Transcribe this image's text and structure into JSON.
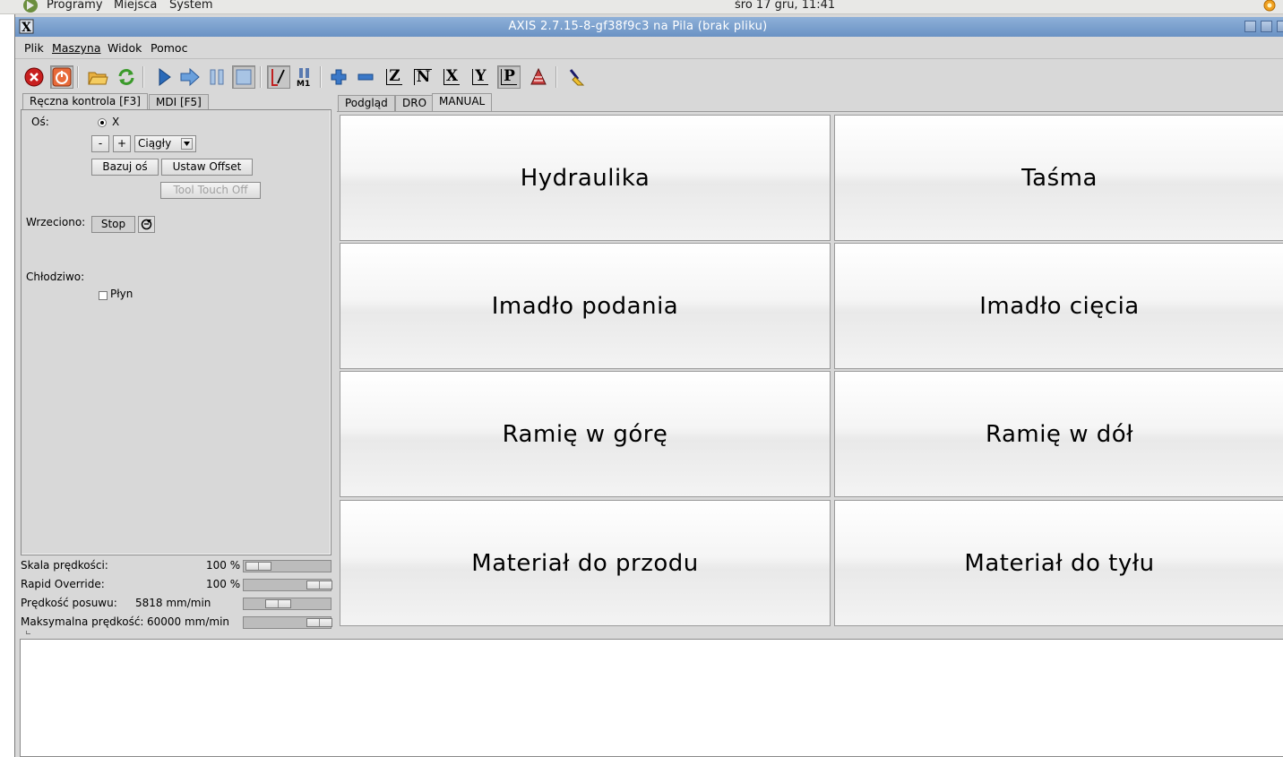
{
  "top_panel": {
    "menu": [
      "Programy",
      "Miejsca",
      "System"
    ],
    "clock": "śro 17 gru, 11:41"
  },
  "window": {
    "title": "AXIS 2.7.15-8-gf38f9c3 na Pila (brak pliku)"
  },
  "menubar": [
    "Plik",
    "Maszyna",
    "Widok",
    "Pomoc"
  ],
  "toolbar": {
    "buttons": [
      "estop-icon",
      "power-icon",
      "open-file-icon",
      "reload-icon",
      "run-icon",
      "step-icon",
      "pause-icon",
      "stop-icon",
      "block-delete-icon",
      "optional-stop-icon",
      "zoom-in-icon",
      "zoom-out-icon",
      "view-z-icon",
      "view-z2-icon",
      "view-x-icon",
      "view-y-icon",
      "view-p-icon",
      "rotate-view-icon",
      "clear-plot-icon"
    ],
    "labels": {
      "z": "Z",
      "z2": "N",
      "x": "X",
      "y": "Y",
      "p": "P",
      "m1": "M1"
    }
  },
  "left": {
    "tabs": [
      "Ręczna kontrola [F3]",
      "MDI [F5]"
    ],
    "axis_label": "Oś:",
    "axis_value": "X",
    "minus": "-",
    "plus": "+",
    "jog_mode": "Ciągły",
    "home_button": "Bazuj oś",
    "offset_button": "Ustaw Offset",
    "touch_off_button": "Tool Touch Off",
    "spindle_label": "Wrzeciono:",
    "spindle_stop": "Stop",
    "coolant_label": "Chłodziwo:",
    "coolant_flood": "Płyn"
  },
  "sliders": [
    {
      "label": "Skala prędkości:",
      "value": "100 %",
      "level": 0.0
    },
    {
      "label": "Rapid Override:",
      "value": "100 %",
      "level": 1.0
    },
    {
      "label": "Prędkość posuwu:",
      "value": "5818 mm/min",
      "level": 0.32
    },
    {
      "label": "Maksymalna prędkość:",
      "value": "60000 mm/min",
      "level": 1.0
    }
  ],
  "right": {
    "tabs": [
      "Podgląd",
      "DRO",
      "MANUAL"
    ],
    "buttons": [
      "Hydraulika",
      "Taśma",
      "Imadło podania",
      "Imadło cięcia",
      "Ramię w górę",
      "Ramię w dół",
      "Materiał do przodu",
      "Materiał do tyłu"
    ]
  }
}
